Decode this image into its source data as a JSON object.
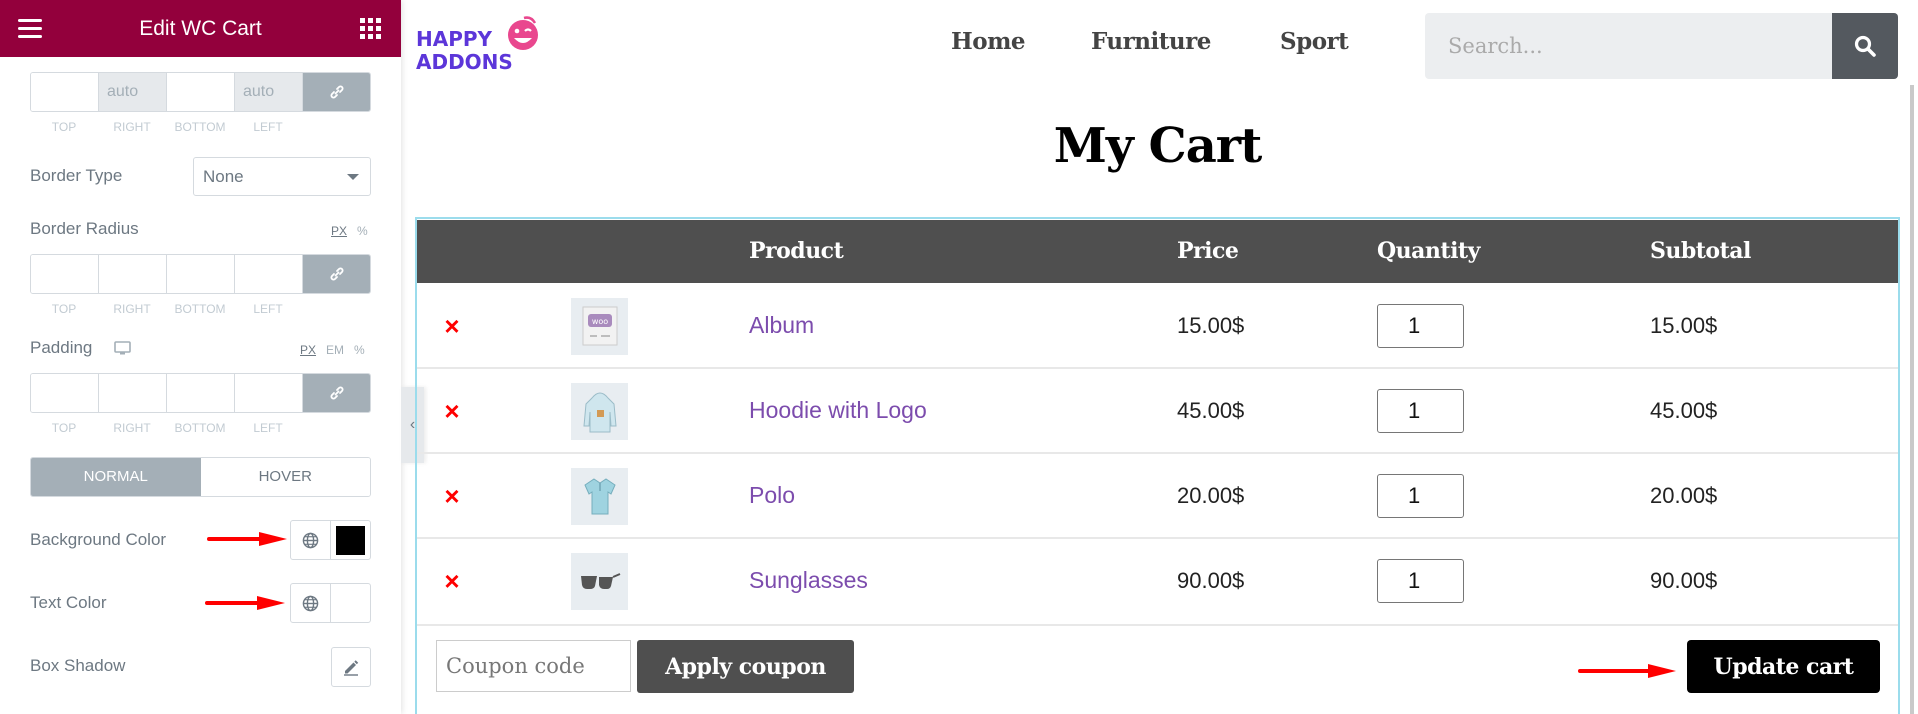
{
  "panel": {
    "title": "Edit WC Cart",
    "margin_dims": {
      "values": [
        "",
        "auto",
        "",
        "auto"
      ],
      "labels": [
        "TOP",
        "RIGHT",
        "BOTTOM",
        "LEFT"
      ]
    },
    "border_type": {
      "label": "Border Type",
      "value": "None"
    },
    "border_radius": {
      "label": "Border Radius",
      "units": [
        "PX",
        "%"
      ],
      "active_unit": "PX",
      "labels": [
        "TOP",
        "RIGHT",
        "BOTTOM",
        "LEFT"
      ]
    },
    "padding": {
      "label": "Padding",
      "units": [
        "PX",
        "EM",
        "%"
      ],
      "active_unit": "PX",
      "labels": [
        "TOP",
        "RIGHT",
        "BOTTOM",
        "LEFT"
      ]
    },
    "tabs": {
      "normal": "NORMAL",
      "hover": "HOVER",
      "active": "NORMAL"
    },
    "background_color": {
      "label": "Background Color",
      "swatch": "#000000"
    },
    "text_color": {
      "label": "Text Color",
      "swatch": ""
    },
    "box_shadow": {
      "label": "Box Shadow"
    }
  },
  "site": {
    "logo": {
      "line1": "HAPPY",
      "line2": "ADDONS"
    },
    "nav": [
      "Home",
      "Furniture",
      "Sport"
    ],
    "search": {
      "placeholder": "Search..."
    },
    "page_title": "My Cart"
  },
  "cart": {
    "columns": [
      "",
      "",
      "Product",
      "Price",
      "Quantity",
      "Subtotal"
    ],
    "rows": [
      {
        "product": "Album",
        "price": "15.00$",
        "quantity": "1",
        "subtotal": "15.00$",
        "thumb": "woo-album-icon"
      },
      {
        "product": "Hoodie with Logo",
        "price": "45.00$",
        "quantity": "1",
        "subtotal": "45.00$",
        "thumb": "hoodie-icon"
      },
      {
        "product": "Polo",
        "price": "20.00$",
        "quantity": "1",
        "subtotal": "20.00$",
        "thumb": "polo-shirt-icon"
      },
      {
        "product": "Sunglasses",
        "price": "90.00$",
        "quantity": "1",
        "subtotal": "90.00$",
        "thumb": "sunglasses-icon"
      }
    ],
    "remove_symbol": "×",
    "coupon_placeholder": "Coupon code",
    "apply_label": "Apply coupon",
    "update_label": "Update cart"
  },
  "colors": {
    "panel_header": "#93003c",
    "table_header": "#4f4f4f",
    "product_link": "#7c4cad",
    "annotation_arrow": "#ff0000"
  }
}
